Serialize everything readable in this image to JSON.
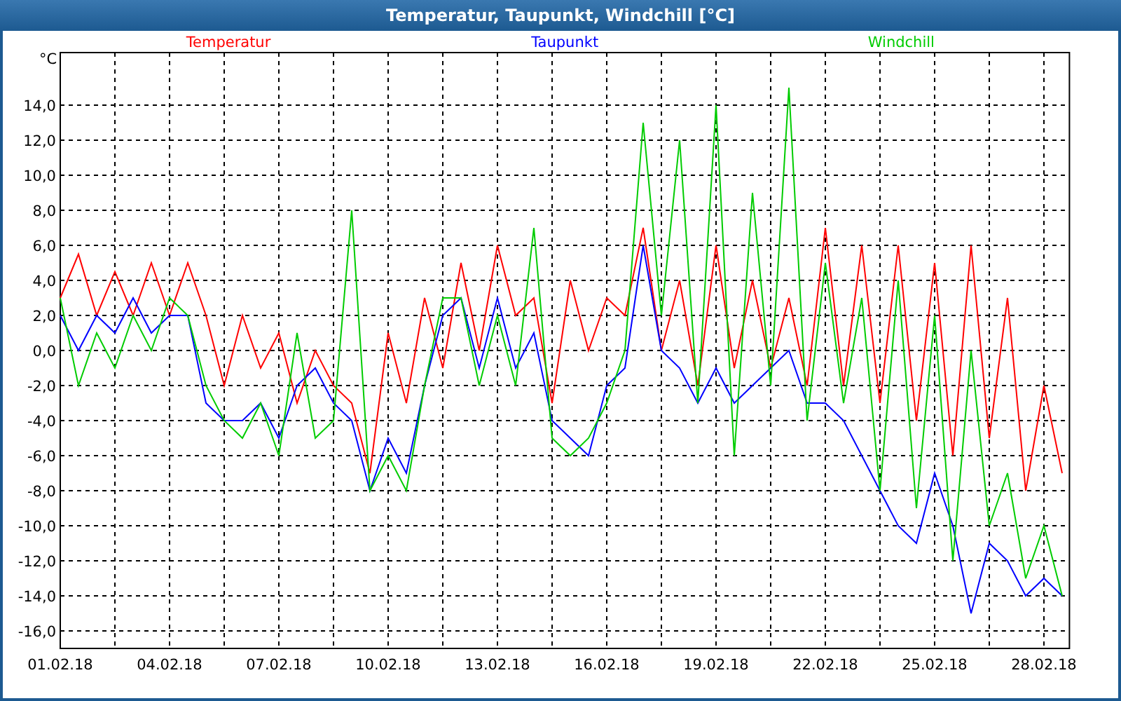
{
  "window": {
    "title": "Temperatur, Taupunkt, Windchill [°C]"
  },
  "chart": {
    "chart_data": {
      "type": "line",
      "grid": true,
      "ylabel": "°C",
      "ylim": [
        -17,
        17
      ],
      "categories": [
        "01.02.18",
        null,
        null,
        null,
        null,
        null,
        "04.02.18",
        null,
        null,
        null,
        null,
        null,
        "07.02.18",
        null,
        null,
        null,
        null,
        null,
        "10.02.18",
        null,
        null,
        null,
        null,
        null,
        "13.02.18",
        null,
        null,
        null,
        null,
        null,
        "16.02.18",
        null,
        null,
        null,
        null,
        null,
        "19.02.18",
        null,
        null,
        null,
        null,
        null,
        "22.02.18",
        null,
        null,
        null,
        null,
        null,
        "25.02.18",
        null,
        null,
        null,
        null,
        null,
        "28.02.18",
        null
      ],
      "yticks": [
        {
          "value": 14,
          "label": "14,0"
        },
        {
          "value": 12,
          "label": "12,0"
        },
        {
          "value": 10,
          "label": "10,0"
        },
        {
          "value": 8,
          "label": "8,0"
        },
        {
          "value": 6,
          "label": "6,0"
        },
        {
          "value": 4,
          "label": "4,0"
        },
        {
          "value": 2,
          "label": "2,0"
        },
        {
          "value": 0,
          "label": "0,0"
        },
        {
          "value": -2,
          "label": "-2,0"
        },
        {
          "value": -4,
          "label": "-4,0"
        },
        {
          "value": -6,
          "label": "-6,0"
        },
        {
          "value": -8,
          "label": "-8,0"
        },
        {
          "value": -10,
          "label": "-10,0"
        },
        {
          "value": -12,
          "label": "-12,0"
        },
        {
          "value": -14,
          "label": "-14,0"
        },
        {
          "value": -16,
          "label": "-16,0"
        }
      ],
      "series": [
        {
          "name": "Temperatur",
          "color": "#ff0000",
          "values": [
            3,
            5.5,
            2,
            4.5,
            2,
            5,
            2,
            5,
            2,
            -2,
            2,
            -1,
            1,
            -3,
            0,
            -2,
            -3,
            -7,
            1,
            -3,
            3,
            -1,
            5,
            0,
            6,
            2,
            3,
            -3,
            4,
            0,
            3,
            2,
            7,
            0,
            4,
            -2,
            6,
            -1,
            4,
            -1,
            3,
            -2,
            7,
            -2,
            6,
            -3,
            6,
            -4,
            5,
            -6,
            6,
            -5,
            3,
            -8,
            -2,
            -7
          ]
        },
        {
          "name": "Taupunkt",
          "color": "#0000ff",
          "values": [
            2,
            0,
            2,
            1,
            3,
            1,
            2,
            2,
            -3,
            -4,
            -4,
            -3,
            -5,
            -2,
            -1,
            -3,
            -4,
            -8,
            -5,
            -7,
            -2,
            2,
            3,
            -1,
            3,
            -1,
            1,
            -4,
            -5,
            -6,
            -2,
            -1,
            6,
            0,
            -1,
            -3,
            -1,
            -3,
            -2,
            -1,
            0,
            -3,
            -3,
            -4,
            -6,
            -8,
            -10,
            -11,
            -7,
            -10,
            -15,
            -11,
            -12,
            -14,
            -13,
            -14
          ]
        },
        {
          "name": "Windchill",
          "color": "#00cc00",
          "values": [
            3,
            -2,
            1,
            -1,
            2,
            0,
            3,
            2,
            -2,
            -4,
            -5,
            -3,
            -6,
            1,
            -5,
            -4,
            8,
            -8,
            -6,
            -8,
            -2,
            3,
            3,
            -2,
            2,
            -2,
            7,
            -5,
            -6,
            -5,
            -3,
            0,
            13,
            2,
            12,
            -3,
            14,
            -6,
            9,
            -2,
            15,
            -4,
            5,
            -3,
            3,
            -8,
            4,
            -9,
            2,
            -12,
            0,
            -10,
            -7,
            -13,
            -10,
            -14
          ]
        }
      ]
    }
  }
}
